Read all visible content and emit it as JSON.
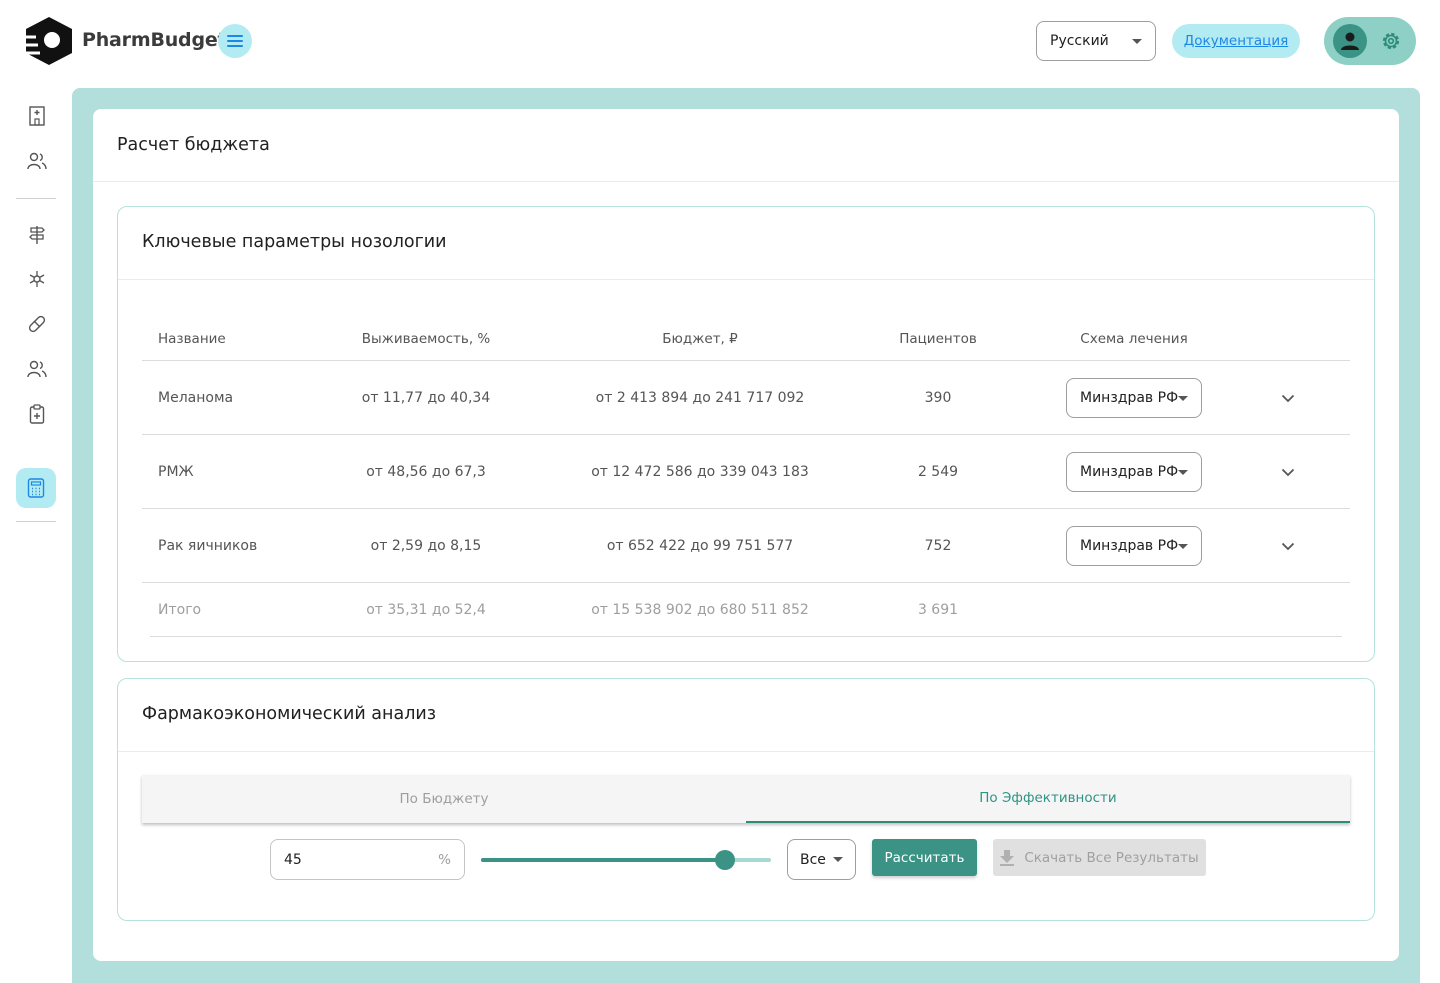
{
  "header": {
    "brand": "PharmBudget",
    "language": "Русский",
    "docs_label": "Документация"
  },
  "sidebar": {
    "items": [
      "hospital-icon",
      "people-icon",
      "signpost-icon",
      "molecule-icon",
      "pill-icon",
      "people-icon",
      "clipboard-icon",
      "calculator-icon"
    ],
    "active": "calculator-icon"
  },
  "page": {
    "title": "Расчет бюджета"
  },
  "nosology": {
    "title": "Ключевые параметры нозологии",
    "columns": [
      "Название",
      "Выживаемость, %",
      "Бюджет, ₽",
      "Пациентов",
      "Схема лечения"
    ],
    "rows": [
      {
        "name": "Меланома",
        "survival": "от 11,77 до 40,34",
        "budget": "от 2 413 894 до 241 717 092",
        "patients": "390",
        "scheme": "Минздрав РФ"
      },
      {
        "name": "РМЖ",
        "survival": "от 48,56 до 67,3",
        "budget": "от 12 472 586 до 339 043 183",
        "patients": "2 549",
        "scheme": "Минздрав РФ"
      },
      {
        "name": "Рак яичников",
        "survival": "от 2,59 до 8,15",
        "budget": "от 652 422 до 99 751 577",
        "patients": "752",
        "scheme": "Минздрав РФ"
      }
    ],
    "total": {
      "name": "Итого",
      "survival": "от 35,31 до 52,4",
      "budget": "от 15 538 902 до 680 511 852",
      "patients": "3 691"
    }
  },
  "analysis": {
    "title": "Фармакоэкономический анализ",
    "tabs": [
      "По Бюджету",
      "По Эффективности"
    ],
    "active_tab": 1,
    "percent_value": "45",
    "percent_unit": "%",
    "slider_fraction": 0.84,
    "filter_value": "Все",
    "calculate_label": "Рассчитать",
    "download_label": "Скачать Все Результаты"
  },
  "colors": {
    "accent": "#3a9384",
    "frame": "#b2dfdb",
    "highlight": "#b2ebf2",
    "link": "#1e88e5"
  }
}
